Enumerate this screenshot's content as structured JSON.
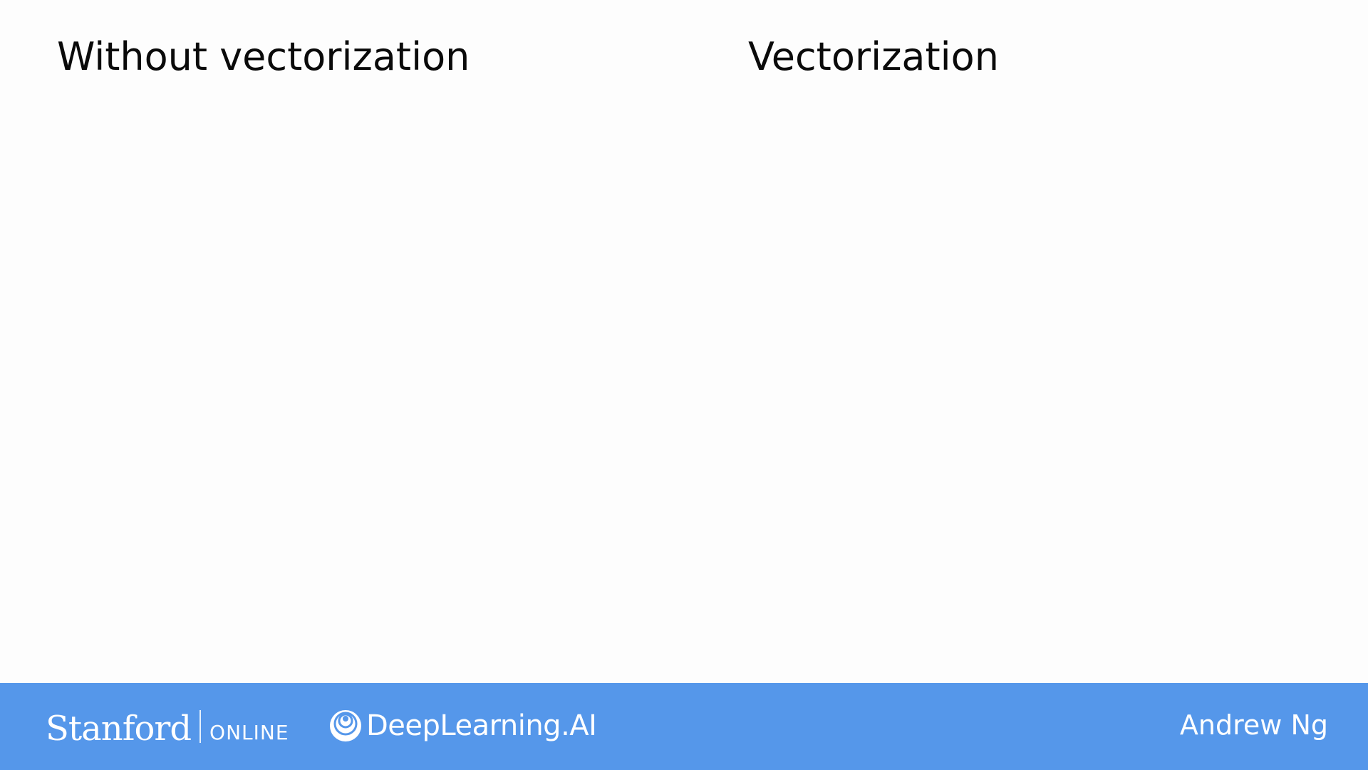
{
  "slide": {
    "left_heading": "Without vectorization",
    "right_heading": "Vectorization"
  },
  "footer": {
    "stanford_word": "Stanford",
    "stanford_online": "ONLINE",
    "deeplearning": "DeepLearning.AI",
    "deeplearning_icon": "deeplearning-logo-icon",
    "presenter": "Andrew Ng",
    "bar_color": "#5597ea"
  }
}
